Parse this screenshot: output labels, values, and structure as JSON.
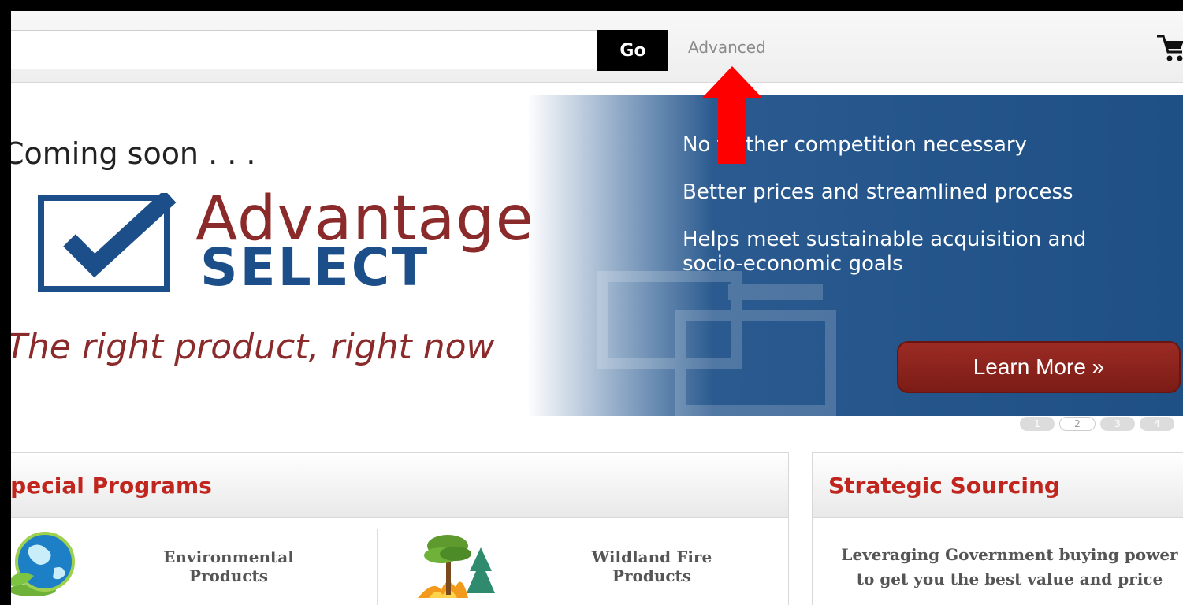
{
  "search": {
    "placeholder": "",
    "go_label": "Go",
    "advanced_label": "Advanced",
    "cart_icon": "shopping-cart-icon"
  },
  "hero": {
    "coming_soon": "Coming soon . . .",
    "brand_line1": "Advantage",
    "brand_line2": "SELECT",
    "tagline": "The right product, right now",
    "benefits": [
      "No further competition necessary",
      "Better prices and streamlined process",
      "Helps meet sustainable acquisition and",
      "socio-economic goals"
    ],
    "learn_more_label": "Learn More »",
    "colors": {
      "brand_red": "#8a2a2a",
      "brand_blue": "#1c4f8a",
      "panel_blue": "#1e4f85"
    }
  },
  "pager": {
    "pages": [
      "1",
      "2",
      "3",
      "4"
    ],
    "active": "2"
  },
  "panels": {
    "special_programs": {
      "title": "Special Programs",
      "items": [
        {
          "label": "Environmental Products",
          "icon": "globe-leaf-icon"
        },
        {
          "label": "Wildland Fire Products",
          "icon": "forest-fire-icon"
        }
      ]
    },
    "strategic_sourcing": {
      "title": "Strategic Sourcing",
      "text": "Leveraging Government buying power to get you the best value and price"
    }
  },
  "annotation": {
    "arrow_color": "#ff0000"
  }
}
